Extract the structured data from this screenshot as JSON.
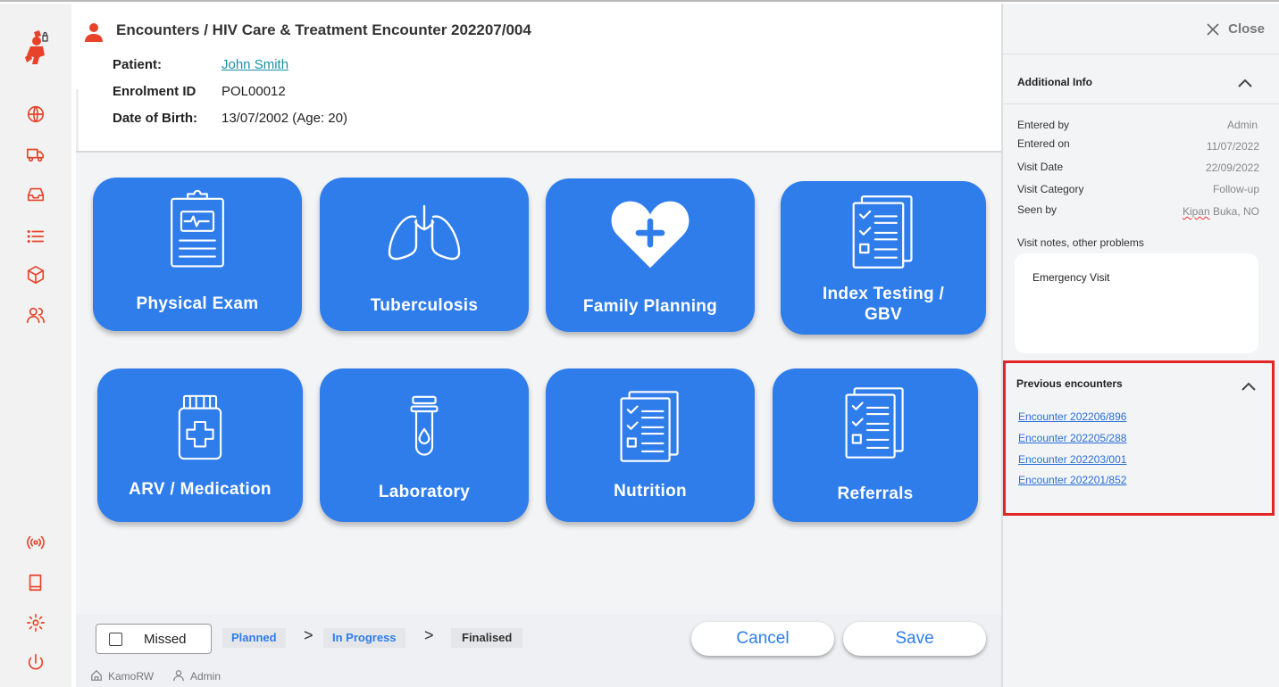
{
  "header": {
    "title": "Encounters / HIV Care & Treatment Encounter 202207/004",
    "patient_label": "Patient:",
    "patient_name": "John Smith",
    "enrolment_label": "Enrolment ID",
    "enrolment_id": "POL00012",
    "dob_label": "Date of Birth:",
    "dob_value": "13/07/2002 (Age: 20)"
  },
  "tiles": [
    {
      "label": "Physical Exam",
      "icon": "clipboard-icon"
    },
    {
      "label": "Tuberculosis",
      "icon": "lungs-icon"
    },
    {
      "label": "Family Planning",
      "icon": "heart-plus-icon"
    },
    {
      "label_line1": "Index Testing /",
      "label_line2": "GBV",
      "icon": "checklist-icon"
    },
    {
      "label": "ARV / Medication",
      "icon": "pill-bottle-icon"
    },
    {
      "label": "Laboratory",
      "icon": "test-tube-icon"
    },
    {
      "label": "Nutrition",
      "icon": "checklist-icon"
    },
    {
      "label": "Referrals",
      "icon": "checklist-icon"
    }
  ],
  "bottombar": {
    "missed_label": "Missed",
    "steps": [
      "Planned",
      "In Progress",
      "Finalised"
    ],
    "cancel_label": "Cancel",
    "save_label": "Save",
    "site": "KamoRW",
    "user": "Admin"
  },
  "panel": {
    "close_label": "Close",
    "additional_info_title": "Additional Info",
    "fields": [
      {
        "label": "Entered by",
        "value": "Admin"
      },
      {
        "label": "Entered  on",
        "value": "11/07/2022"
      },
      {
        "label": "Visit Date",
        "value": "22/09/2022"
      },
      {
        "label": "Visit Category",
        "value": "Follow-up"
      },
      {
        "label": "Seen by",
        "value_flagged": "Kipan",
        "value_rest": " Buka, NO"
      }
    ],
    "notes_label": "Visit notes, other problems",
    "notes_value": "Emergency Visit",
    "previous_title": "Previous encounters",
    "previous": [
      "Encounter 202206/896",
      "Encounter 202205/288",
      "Encounter 202203/001",
      "Encounter 202201/852"
    ]
  },
  "colors": {
    "accent": "#2f7deb",
    "nav_icon": "#e8432a",
    "highlight": "#e52525",
    "link": "#2a6fd6"
  }
}
